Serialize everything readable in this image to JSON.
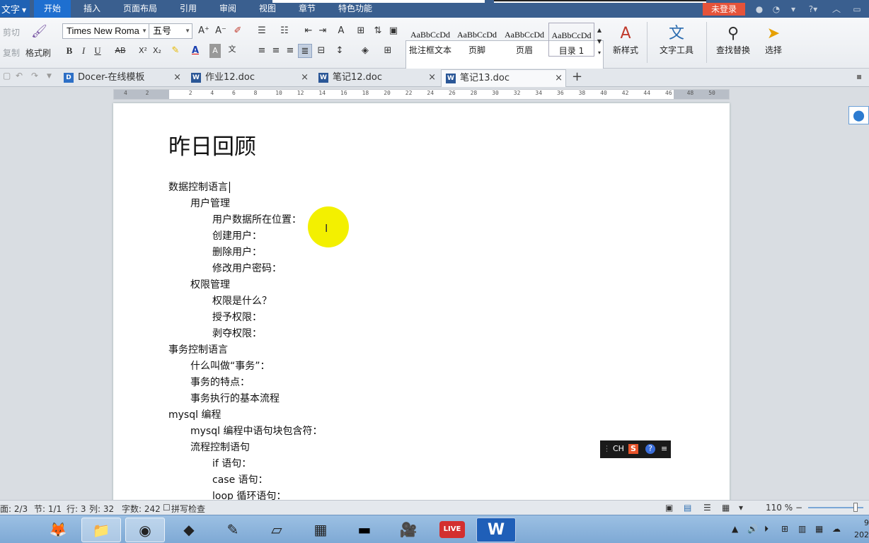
{
  "menubar": {
    "app_label": "文字",
    "tabs": [
      "开始",
      "插入",
      "页面布局",
      "引用",
      "审阅",
      "视图",
      "章节",
      "特色功能"
    ],
    "login_label": "未登录",
    "icons": [
      "skin-icon",
      "feedback-icon",
      "shirt-icon",
      "help-icon",
      "collapse-ribbon-icon"
    ],
    "help_glyph": "?"
  },
  "ribbon": {
    "cut_label": "剪切",
    "copy_label": "复制",
    "format_painter_label": "格式刷",
    "font_name": "Times New Roma",
    "font_size": "五号",
    "styles": [
      {
        "sample": "AaBbCcDd",
        "label": "批注框文本"
      },
      {
        "sample": "AaBbCcDd",
        "label": "页脚"
      },
      {
        "sample": "AaBbCcDd",
        "label": "页眉"
      },
      {
        "sample": "AaBbCcDd",
        "label": "目录 1"
      }
    ],
    "new_style_label": "新样式",
    "text_tools_label": "文字工具",
    "find_replace_label": "查找替换",
    "select_label": "选择"
  },
  "tabs": {
    "documents": [
      {
        "name": "Docer-在线模板",
        "icon": "D"
      },
      {
        "name": "作业12.doc",
        "icon": "W"
      },
      {
        "name": "笔记12.doc",
        "icon": "W"
      },
      {
        "name": "笔记13.doc",
        "icon": "W"
      }
    ],
    "close_glyph": "×",
    "new_tab_glyph": "+"
  },
  "ruler": {
    "ticks": [
      "4",
      "2",
      "",
      "2",
      "4",
      "6",
      "8",
      "10",
      "12",
      "14",
      "16",
      "18",
      "20",
      "22",
      "24",
      "26",
      "28",
      "30",
      "32",
      "34",
      "36",
      "38",
      "40",
      "42",
      "44",
      "46",
      "48",
      "50"
    ]
  },
  "document": {
    "title": "昨日回顾",
    "lines": [
      {
        "text": "数据控制语言",
        "indent": 0,
        "cursor": true
      },
      {
        "text": "用户管理",
        "indent": 1
      },
      {
        "text": "用户数据所在位置：",
        "indent": 2
      },
      {
        "text": "创建用户：",
        "indent": 2
      },
      {
        "text": "删除用户：",
        "indent": 2
      },
      {
        "text": "修改用户密码：",
        "indent": 2
      },
      {
        "text": "权限管理",
        "indent": 1
      },
      {
        "text": "权限是什么？",
        "indent": 2
      },
      {
        "text": "授予权限：",
        "indent": 2
      },
      {
        "text": "剥夺权限：",
        "indent": 2
      },
      {
        "text": "事务控制语言",
        "indent": 0
      },
      {
        "text": "什么叫做“事务”：",
        "indent": 1
      },
      {
        "text": "事务的特点：",
        "indent": 1
      },
      {
        "text": "事务执行的基本流程",
        "indent": 1
      },
      {
        "text": "mysql 编程",
        "indent": 0
      },
      {
        "text": "mysql 编程中语句块包含符：",
        "indent": 1
      },
      {
        "text": "流程控制语句",
        "indent": 1
      },
      {
        "text": "if 语句：",
        "indent": 2
      },
      {
        "text": "case 语句：",
        "indent": 2
      },
      {
        "text": "loop 循环语句：",
        "indent": 2
      }
    ]
  },
  "ime": {
    "label": "CH",
    "sogou": "S",
    "help": "?"
  },
  "status": {
    "page": "面: 2/3",
    "section": "节: 1/1",
    "row": "行: 3",
    "col": "列: 32",
    "word_count": "字数: 242",
    "spellcheck": "拼写检查",
    "zoom": "110 %",
    "zoom_minus": "−",
    "zoom_fraction": 0.82
  },
  "taskbar": {
    "apps": [
      {
        "name": "firefox-icon",
        "glyph": "🦊",
        "open": false
      },
      {
        "name": "explorer-icon",
        "glyph": "📁",
        "open": true
      },
      {
        "name": "chrome-icon",
        "glyph": "◉",
        "open": true
      },
      {
        "name": "media-icon",
        "glyph": "◆",
        "open": false
      },
      {
        "name": "notes-icon",
        "glyph": "✎",
        "open": false
      },
      {
        "name": "paper-icon",
        "glyph": "▱",
        "open": false
      },
      {
        "name": "calculator-icon",
        "glyph": "▦",
        "open": false
      },
      {
        "name": "terminal-icon",
        "glyph": "▬",
        "open": false
      },
      {
        "name": "camera-icon",
        "glyph": "🎥",
        "open": false
      },
      {
        "name": "live-icon",
        "glyph": "LIVE",
        "open": false
      },
      {
        "name": "wps-writer-icon",
        "glyph": "W",
        "open": true
      }
    ],
    "clock_time": "9",
    "clock_date": "202"
  },
  "colors": {
    "menubar_bg": "#3a5f8f",
    "active_tab": "#1e6fd0",
    "login": "#e5533a",
    "highlight": "#f3f000"
  }
}
